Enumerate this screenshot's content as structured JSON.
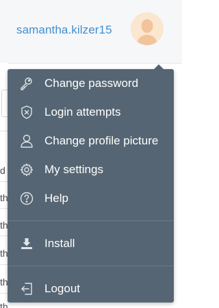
{
  "header": {
    "username": "samantha.kilzer15",
    "avatar_icon": "user-avatar-icon"
  },
  "background": {
    "fragments": [
      "d",
      "th",
      "th",
      "th",
      "th",
      "th"
    ]
  },
  "menu": {
    "items": [
      {
        "label": "Change password",
        "icon": "key-icon"
      },
      {
        "label": "Login attempts",
        "icon": "shield-icon"
      },
      {
        "label": "Change profile picture",
        "icon": "user-icon"
      },
      {
        "label": "My settings",
        "icon": "gear-icon"
      },
      {
        "label": "Help",
        "icon": "help-icon"
      }
    ],
    "install": {
      "label": "Install",
      "icon": "download-icon"
    },
    "logout": {
      "label": "Logout",
      "icon": "logout-icon"
    }
  },
  "colors": {
    "menu_bg": "#566573",
    "username": "#3d8fd1",
    "header_bg": "#f6f7f9"
  }
}
